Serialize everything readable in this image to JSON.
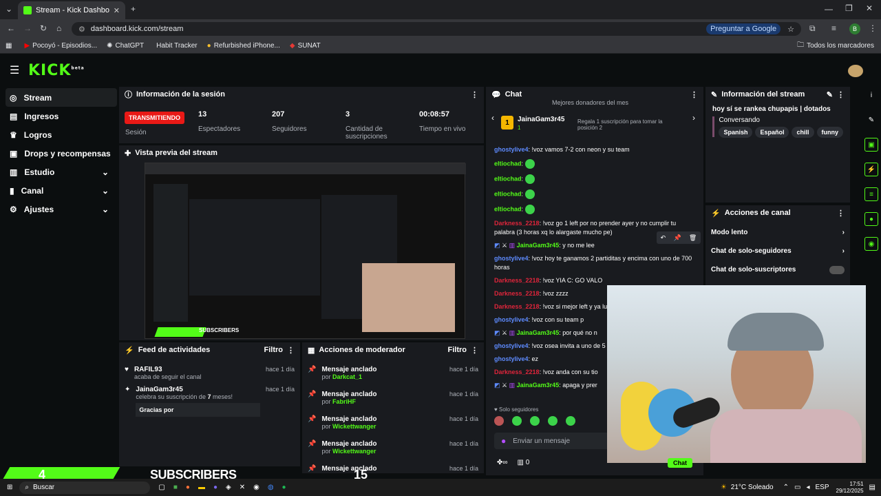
{
  "browser": {
    "tab_title": "Stream - Kick Dashboard",
    "url": "dashboard.kick.com/stream",
    "google_btn": "Preguntar a Google",
    "profile_initial": "B",
    "bookmarks": [
      "Pocoyó - Episodios...",
      "ChatGPT",
      "Habit Tracker",
      "Refurbished iPhone...",
      "SUNAT"
    ],
    "all_bookmarks": "Todos los marcadores"
  },
  "app": {
    "logo": "KICK",
    "logo_tag": "beta",
    "sidebar": [
      {
        "label": "Stream",
        "icon": "dual-circle-icon",
        "active": true
      },
      {
        "label": "Ingresos",
        "icon": "bank-icon"
      },
      {
        "label": "Logros",
        "icon": "trophy-icon"
      },
      {
        "label": "Drops y recompensas",
        "icon": "gift-icon"
      },
      {
        "label": "Estudio",
        "icon": "layout-icon",
        "chevron": true
      },
      {
        "label": "Canal",
        "icon": "chart-icon",
        "chevron": true
      },
      {
        "label": "Ajustes",
        "icon": "gear-icon",
        "chevron": true
      }
    ],
    "session": {
      "title": "Información de la sesión",
      "status": "TRANSMITIENDO",
      "status_label": "Sesión",
      "stats": [
        {
          "value": "13",
          "label": "Espectadores"
        },
        {
          "value": "207",
          "label": "Seguidores"
        },
        {
          "value": "3",
          "label": "Cantidad de suscripciones"
        },
        {
          "value": "00:08:57",
          "label": "Tiempo en vivo"
        }
      ]
    },
    "preview": {
      "title": "Vista previa del stream",
      "overlay": "SUBSCRIBERS"
    },
    "activity": {
      "title": "Feed de actividades",
      "filter": "Filtro",
      "items": [
        {
          "user": "RAFIL93",
          "text": "acaba de seguir el canal",
          "time": "hace 1 día"
        },
        {
          "user": "JainaGam3r45",
          "text_pre": "celebra su suscripción de ",
          "months": "7",
          "text_post": " meses!",
          "time": "hace 1 día",
          "message": "Gracias por"
        }
      ]
    },
    "modactions": {
      "title": "Acciones de moderador",
      "filter": "Filtro",
      "items": [
        {
          "title": "Mensaje anclado",
          "by": "por",
          "user": "Darkcat_1",
          "time": "hace 1 día"
        },
        {
          "title": "Mensaje anclado",
          "by": "por",
          "user": "FabriHF",
          "time": "hace 1 día"
        },
        {
          "title": "Mensaje anclado",
          "by": "por",
          "user": "Wickettwanger",
          "time": "hace 1 día"
        },
        {
          "title": "Mensaje anclado",
          "by": "por",
          "user": "Wickettwanger",
          "time": "hace 1 día"
        },
        {
          "title": "Mensaje anclado",
          "time": "hace 1 día"
        }
      ]
    },
    "chat": {
      "title": "Chat",
      "pinned_heading": "Mejores donadores del mes",
      "top_donor": {
        "rank": "1",
        "name": "JainaGam3r45",
        "count": "1"
      },
      "gift_text": "Regala 1 suscripción para tomar la posición 2",
      "messages": [
        {
          "user": "ghostylive4",
          "cls": "u-g",
          "text": ": !voz vamos 7-2 con neon y su team"
        },
        {
          "user": "eltiochad",
          "cls": "u-gr",
          "text": ":",
          "emote": true
        },
        {
          "user": "eltiochad",
          "cls": "u-gr",
          "text": ":",
          "emote": true
        },
        {
          "user": "eltiochad",
          "cls": "u-gr",
          "text": ":",
          "emote": true
        },
        {
          "user": "eltiochad",
          "cls": "u-gr",
          "text": ":",
          "emote": true
        },
        {
          "user": "Darkness_2218",
          "cls": "u-r",
          "text": ": !voz go 1 left por no prender ayer y no cumplir tu palabra (3 horas xq lo alargaste mucho pe)"
        },
        {
          "user": "JainaGam3r45",
          "cls": "u-gr",
          "text": ": y no me lee",
          "badges": true
        },
        {
          "user": "ghostylive4",
          "cls": "u-g",
          "text": ": !voz hoy te ganamos 2 partiditas y encima con uno de 700 horas"
        },
        {
          "user": "Darkness_2218",
          "cls": "u-r",
          "text": ": !voz YIA C: GO VALO"
        },
        {
          "user": "Darkness_2218",
          "cls": "u-r",
          "text": ": !voz zzzz"
        },
        {
          "user": "Darkness_2218",
          "cls": "u-r",
          "text": ": !voz si mejor left y ya lu"
        },
        {
          "user": "ghostylive4",
          "cls": "u-g",
          "text": ": !voz con su team p"
        },
        {
          "user": "JainaGam3r45",
          "cls": "u-gr",
          "text": ": por qué no n",
          "badges": true
        },
        {
          "user": "ghostylive4",
          "cls": "u-g",
          "text": ": !voz osea invita a uno de 5"
        },
        {
          "user": "ghostylive4",
          "cls": "u-g",
          "text": ": ez"
        },
        {
          "user": "Darkness_2218",
          "cls": "u-r",
          "text": ": !voz anda con su tio"
        },
        {
          "user": "JainaGam3r45",
          "cls": "u-gr",
          "text": ": apaga y prer",
          "badges": true
        }
      ],
      "followers_only": "Solo seguidores",
      "input_placeholder": "Enviar un mensaje",
      "points": "0",
      "send": "Chat"
    },
    "stream_info": {
      "title": "Información del stream",
      "stream_title": "hoy sí se rankea chupapis | dotados",
      "category": "Conversando",
      "tags": [
        "Spanish",
        "Español",
        "chill",
        "funny"
      ]
    },
    "channel_actions": {
      "title": "Acciones de canal",
      "items": [
        {
          "label": "Modo lento"
        },
        {
          "label": "Chat de solo-seguidores"
        },
        {
          "label": "Chat de solo-suscriptores"
        }
      ]
    }
  },
  "overlay": {
    "sub_count": "4",
    "sub_label": "SUBSCRIBERS",
    "sub_goal": "15"
  },
  "taskbar": {
    "search": "Buscar",
    "weather": "21°C Soleado",
    "lang": "ESP",
    "time": "17:51",
    "date": "29/12/2025"
  }
}
